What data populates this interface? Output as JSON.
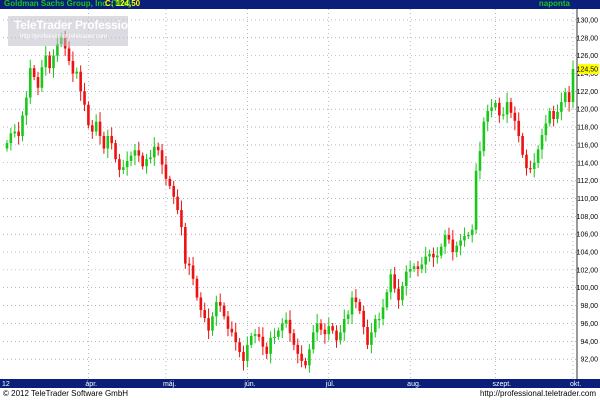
{
  "header": {
    "title": "Goldman Sachs Group, Inc. (The)",
    "close_label": "C: 124,50",
    "interval": "naponta"
  },
  "watermark": {
    "name": "TeleTrader Professional",
    "url": "http://professional.teletrader.com"
  },
  "footer": {
    "copyright": "© 2012 TeleTrader Software GmbH",
    "source": "http://professional.teletrader.com"
  },
  "colors": {
    "up": "#18c818",
    "down": "#ee1111",
    "bar": "#0b1f7a",
    "last": "#ffff00"
  },
  "chart_data": {
    "type": "candlestick",
    "ylim": [
      90,
      131
    ],
    "y_ticks": [
      "130,00",
      "128,00",
      "126,00",
      "124,00",
      "122,00",
      "120,00",
      "118,00",
      "116,00",
      "114,00",
      "112,00",
      "110,00",
      "108,00",
      "106,00",
      "104,00",
      "102,00",
      "100,00",
      "98,00",
      "96,00",
      "94,00",
      "92,00"
    ],
    "last_value": "124,50",
    "x_ticks": [
      {
        "label": "12",
        "index": 0
      },
      {
        "label": "ápr.",
        "index": 21
      },
      {
        "label": "máj.",
        "index": 41
      },
      {
        "label": "jún.",
        "index": 62
      },
      {
        "label": "júl.",
        "index": 83
      },
      {
        "label": "aug.",
        "index": 104
      },
      {
        "label": "szept.",
        "index": 126
      },
      {
        "label": "okt.",
        "index": 146
      }
    ],
    "closes": [
      116.2,
      117.3,
      117.5,
      117.0,
      119.3,
      121.3,
      124.6,
      123.6,
      122.4,
      124.7,
      126.0,
      124.6,
      126.0,
      127.3,
      128.2,
      126.8,
      125.4,
      124.0,
      124.2,
      122.0,
      120.5,
      118.2,
      117.5,
      118.6,
      117.0,
      115.6,
      117.0,
      116.2,
      114.4,
      113.2,
      113.5,
      114.2,
      114.8,
      115.4,
      114.8,
      113.6,
      114.4,
      114.6,
      115.8,
      115.4,
      113.8,
      112.2,
      111.4,
      110.2,
      108.7,
      106.8,
      102.7,
      102.5,
      101.0,
      98.9,
      97.5,
      96.6,
      95.2,
      96.8,
      98.4,
      98.0,
      96.8,
      95.4,
      95.0,
      93.9,
      92.8,
      91.8,
      93.6,
      94.6,
      94.8,
      94.5,
      93.4,
      92.6,
      94.4,
      94.5,
      95.2,
      96.0,
      96.4,
      94.9,
      93.6,
      92.6,
      91.8,
      91.3,
      93.1,
      95.0,
      96.0,
      95.3,
      94.8,
      95.7,
      95.2,
      94.1,
      95.0,
      96.5,
      97.0,
      98.9,
      98.4,
      97.4,
      95.6,
      93.6,
      95.0,
      96.5,
      96.5,
      97.8,
      99.5,
      101.5,
      99.9,
      98.6,
      100.2,
      101.8,
      102.1,
      102.4,
      102.1,
      102.6,
      103.5,
      103.8,
      103.4,
      103.6,
      104.6,
      105.9,
      105.4,
      104.0,
      104.7,
      105.3,
      105.8,
      105.9,
      106.5,
      113.1,
      115.3,
      118.6,
      119.8,
      120.2,
      120.7,
      119.3,
      119.4,
      120.8,
      119.6,
      118.7,
      117.0,
      114.9,
      113.4,
      113.3,
      114.0,
      115.5,
      117.1,
      118.4,
      119.8,
      118.9,
      119.7,
      120.8,
      121.9,
      120.8,
      124.5
    ]
  }
}
